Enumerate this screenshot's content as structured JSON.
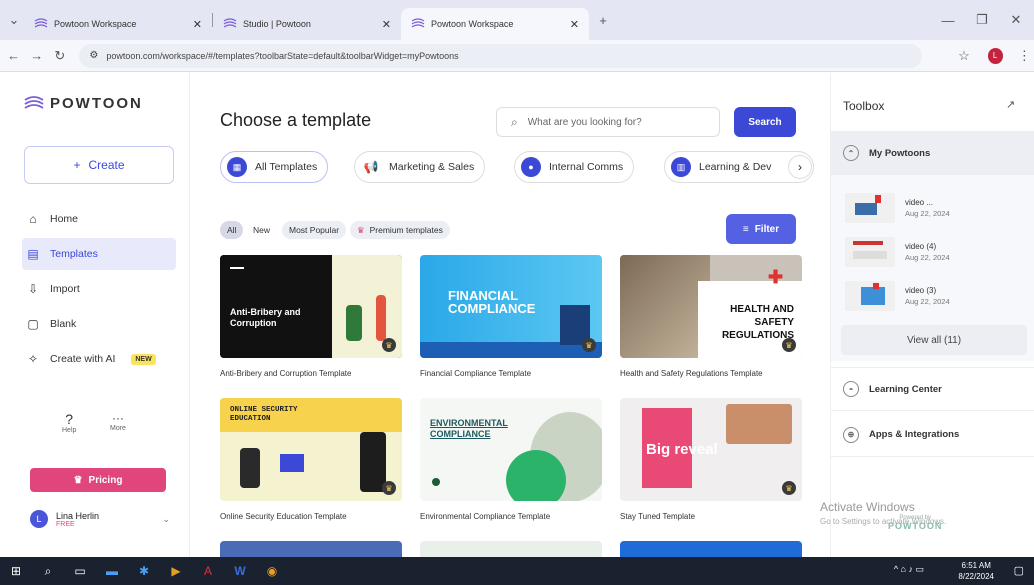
{
  "browser": {
    "tabs": [
      {
        "title": "Powtoon Workspace"
      },
      {
        "title": "Studio | Powtoon"
      },
      {
        "title": "Powtoon Workspace"
      }
    ],
    "url": "powtoon.com/workspace/#/templates?toolbarState=default&toolbarWidget=myPowtoons",
    "profile_initial": "L"
  },
  "sidebar": {
    "logo": "POWTOON",
    "create_label": "Create",
    "nav": [
      {
        "label": "Home"
      },
      {
        "label": "Templates"
      },
      {
        "label": "Import"
      },
      {
        "label": "Blank"
      },
      {
        "label": "Create with AI"
      }
    ],
    "new_badge": "NEW",
    "help_label": "Help",
    "more_label": "More",
    "pricing_label": "Pricing",
    "user_name": "Lina Herlin",
    "user_plan": "FREE",
    "avatar_initial": "L"
  },
  "main": {
    "title": "Choose a template",
    "search_placeholder": "What are you looking for?",
    "search_button": "Search",
    "categories": [
      {
        "label": "All Templates"
      },
      {
        "label": "Marketing & Sales"
      },
      {
        "label": "Internal Comms"
      },
      {
        "label": "Learning & Dev"
      }
    ],
    "filters": [
      {
        "label": "All"
      },
      {
        "label": "New"
      },
      {
        "label": "Most Popular"
      },
      {
        "label": "Premium templates"
      }
    ],
    "filter_button": "Filter",
    "templates": [
      {
        "label": "Anti-Bribery and Corruption Template",
        "thumb_text": "Anti-Bribery and Corruption"
      },
      {
        "label": "Financial Compliance Template",
        "thumb_text": "FINANCIAL COMPLIANCE"
      },
      {
        "label": "Health and Safety Regulations Template",
        "thumb_text": "HEALTH AND SAFETY REGULATIONS"
      },
      {
        "label": "Online Security Education Template",
        "thumb_text": "ONLINE SECURITY EDUCATION"
      },
      {
        "label": "Environmental Compliance Template",
        "thumb_text": "ENVIRONMENTAL COMPLIANCE"
      },
      {
        "label": "Stay Tuned Template",
        "thumb_text": "Big reveal"
      }
    ]
  },
  "toolbox": {
    "title": "Toolbox",
    "my_powtoons": "My Powtoons",
    "videos": [
      {
        "name": "video ...",
        "date": "Aug 22, 2024"
      },
      {
        "name": "video (4)",
        "date": "Aug 22, 2024"
      },
      {
        "name": "video (3)",
        "date": "Aug 22, 2024"
      }
    ],
    "view_all": "View all (11)",
    "learning_center": "Learning Center",
    "apps": "Apps & Integrations"
  },
  "overlay": {
    "activate_title": "Activate Windows",
    "activate_sub": "Go to Settings to activate Windows.",
    "powered_by": "Powered by",
    "powered_brand": "POWTOON"
  },
  "taskbar": {
    "time": "6:51 AM",
    "date": "8/22/2024"
  }
}
